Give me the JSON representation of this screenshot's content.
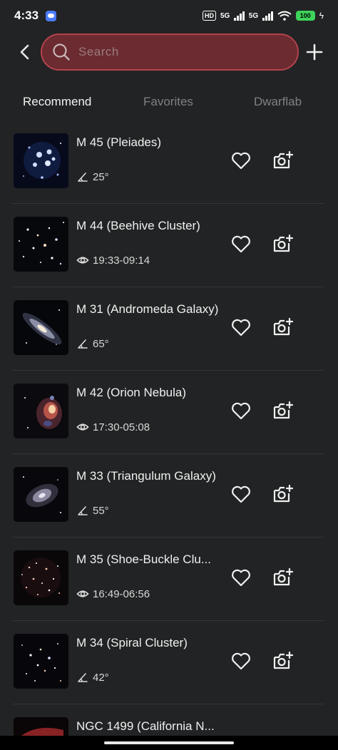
{
  "status_bar": {
    "time": "4:33",
    "hd": "HD",
    "network1": "5G",
    "network2": "5G",
    "battery": "100"
  },
  "search": {
    "placeholder": "Search"
  },
  "tabs": [
    {
      "label": "Recommend",
      "active": true
    },
    {
      "label": "Favorites",
      "active": false
    },
    {
      "label": "Dwarflab",
      "active": false
    }
  ],
  "items": [
    {
      "title": "M 45 (Pleiades)",
      "meta_icon": "altitude-angle-icon",
      "meta": "25°"
    },
    {
      "title": "M 44 (Beehive Cluster)",
      "meta_icon": "eye-icon",
      "meta": "19:33-09:14"
    },
    {
      "title": "M 31 (Andromeda Galaxy)",
      "meta_icon": "altitude-angle-icon",
      "meta": "65°"
    },
    {
      "title": "M 42 (Orion Nebula)",
      "meta_icon": "eye-icon",
      "meta": "17:30-05:08"
    },
    {
      "title": "M 33 (Triangulum Galaxy)",
      "meta_icon": "altitude-angle-icon",
      "meta": "55°"
    },
    {
      "title": "M 35 (Shoe-Buckle Clu...",
      "meta_icon": "eye-icon",
      "meta": "16:49-06:56"
    },
    {
      "title": "M 34 (Spiral Cluster)",
      "meta_icon": "altitude-angle-icon",
      "meta": "42°"
    },
    {
      "title": "NGC 1499 (California N...",
      "meta_icon": "",
      "meta": ""
    }
  ],
  "colors": {
    "background": "#222324",
    "search_fill": "#6b2b30",
    "search_border": "#b4434c",
    "battery": "#3ed35a"
  }
}
